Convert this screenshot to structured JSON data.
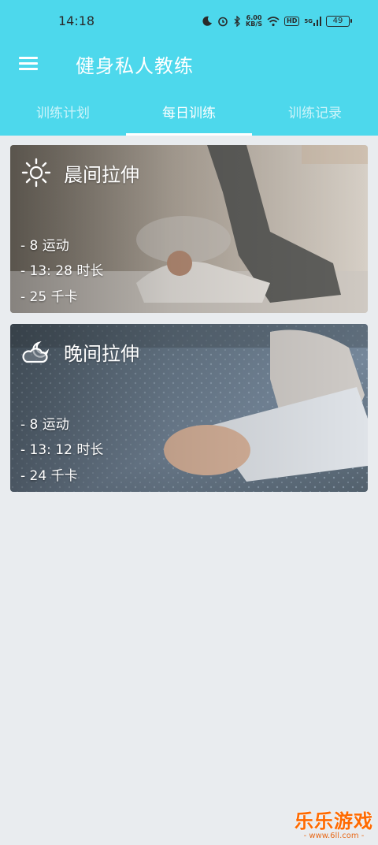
{
  "status_bar": {
    "time": "14:18",
    "speed_value": "6.00",
    "speed_unit": "KB/S",
    "hd_label": "HD",
    "signal_label": "5G",
    "battery": "49"
  },
  "toolbar": {
    "title": "健身私人教练"
  },
  "tabs": [
    {
      "label": "训练计划",
      "active": false
    },
    {
      "label": "每日训练",
      "active": true
    },
    {
      "label": "训练记录",
      "active": false
    }
  ],
  "cards": [
    {
      "title": "晨间拉伸",
      "icon": "sun-icon",
      "stats": [
        "- 8 运动",
        "- 13: 28 时长",
        "- 25 千卡"
      ]
    },
    {
      "title": "晚间拉伸",
      "icon": "moon-cloud-icon",
      "stats": [
        "- 8 运动",
        "- 13: 12 时长",
        "- 24 千卡"
      ]
    }
  ],
  "watermark": {
    "logo": "乐乐游戏",
    "url": "- www.6ll.com -"
  },
  "colors": {
    "accent": "#4dd8ec",
    "background": "#e9ecef",
    "watermark": "#ff6a00"
  }
}
